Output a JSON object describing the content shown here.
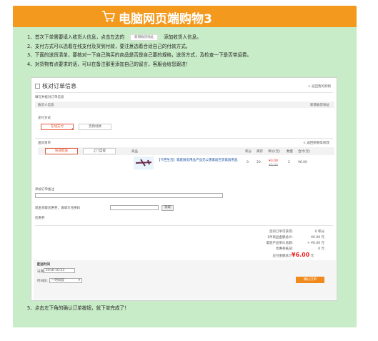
{
  "banner": {
    "title": "电脑网页端购物3",
    "icon": "shopping-cart-icon",
    "bg_color": "#f39a1e"
  },
  "instructions": {
    "step1_prefix": "1、首次下单需要填入收货人信息，点击左边的",
    "step1_chip": "新增收货地址",
    "step1_suffix": "添加收货人信息。",
    "step2": "2、支付方式可以选着在线支付及货到付款，要注意选着合适自己的付款方式。",
    "step3": "3、下面的送货清单，要核对一下自己购买的商品是否是自己要的规格，送货方式，及检查一下是否带运费。",
    "step4": "4、对货物有点要求的话，可以在备注那里添加自己的留言，客服会给您跟进！",
    "step5": "5、点击左下角的确认订单按钮，就下单完成了！"
  },
  "order": {
    "title": "核对订单信息",
    "back_link": "< 返回我的购物",
    "subtitle": "填写并核对订单信息",
    "receiver": {
      "label": "收货人信息",
      "add_link": "新增收货地址"
    },
    "payment": {
      "label": "支付方式",
      "options": [
        "在线支付",
        "货到付款"
      ],
      "selected": "在线支付"
    },
    "delivery": {
      "label": "送货清单",
      "back_cart": "< 返回购物车修改",
      "tabs": [
        "快递配送",
        "上门自提"
      ],
      "selected_tab": "快递配送",
      "columns": [
        "商品",
        "积分",
        "库存",
        "单价(元)",
        "数量",
        "合计(元)"
      ],
      "items": [
        {
          "name": "【卡西生活】家庭厨房用品产品无公害家居百货家居用品",
          "points": "0",
          "stock": "20",
          "price": "¥3.00",
          "original_price": "¥3.00",
          "qty": "2",
          "subtotal": "¥6.00"
        }
      ]
    },
    "remark": {
      "label": "添加订单备注"
    },
    "coupon": {
      "label": "现金领取优惠券，请填写兑换码",
      "button": "领取"
    },
    "discount_label": "优惠券",
    "summary": {
      "rows": [
        {
          "label": "您的订单可获得:",
          "value": "0 积分"
        },
        {
          "label": "1件商品金额总计:",
          "value": "¥6.00 元"
        },
        {
          "label": "着装产品单价总额:",
          "value": "+ ¥0.00 元"
        },
        {
          "label": "优惠券抵减:",
          "value": "0 元"
        }
      ],
      "total_label": "应付金额总计:",
      "total_value": "¥6.00",
      "total_unit": "元"
    },
    "shipping": {
      "label": "配送时间",
      "date_label": "日期",
      "date_value": "2016-10-23",
      "time_label": "时间段:",
      "time_value": "一时间段"
    },
    "confirm_button": "确认订单"
  }
}
